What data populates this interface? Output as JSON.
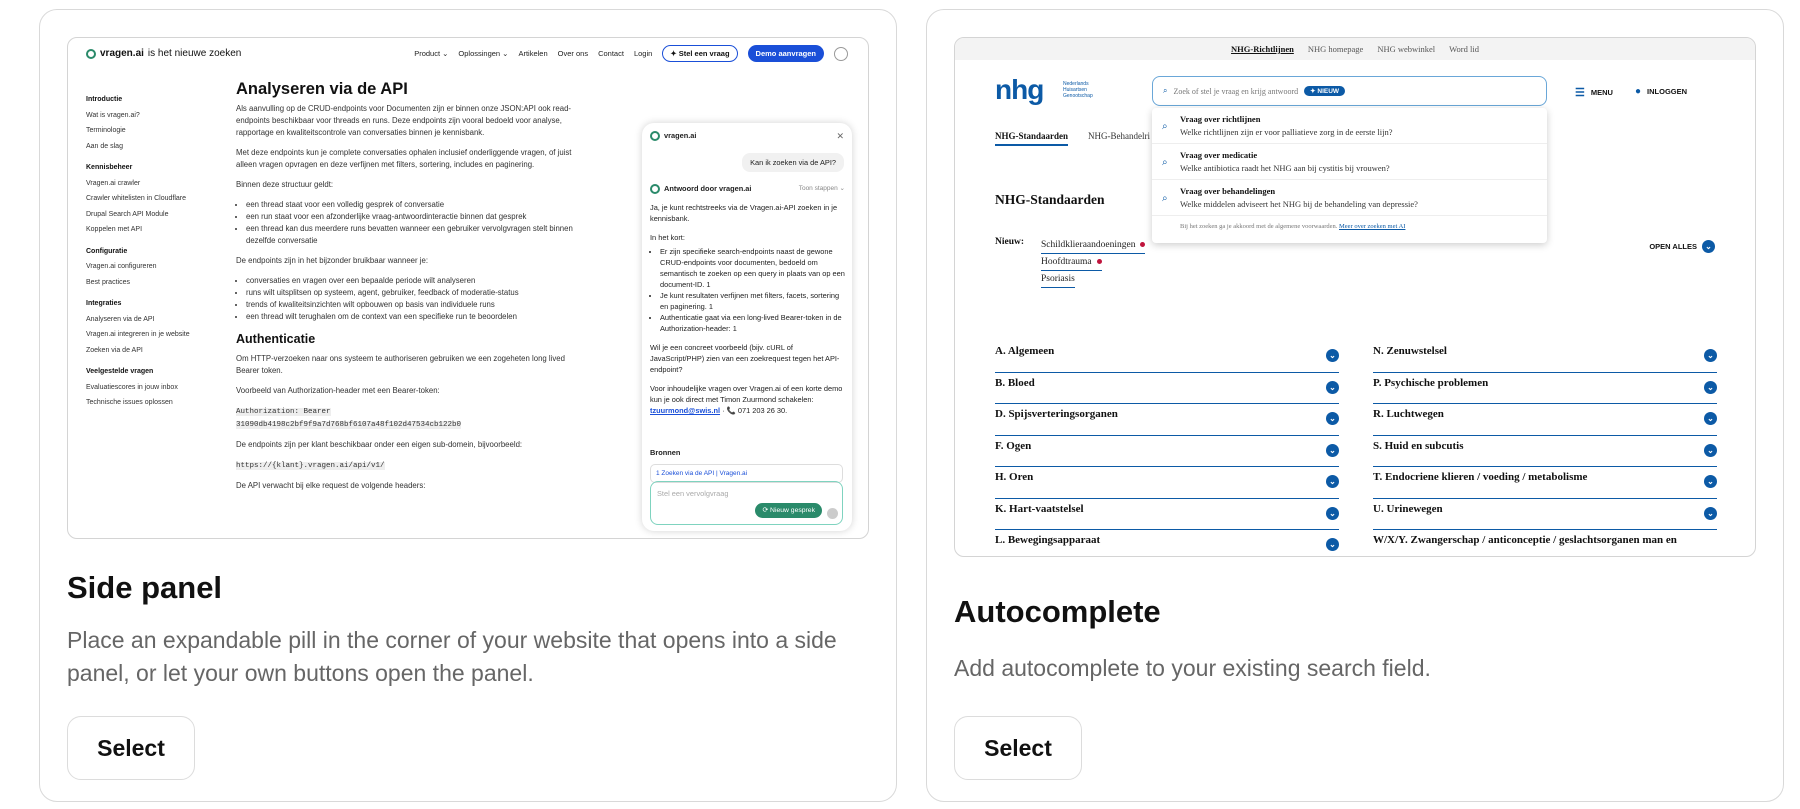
{
  "cards": [
    {
      "title": "Side panel",
      "description": "Place an expandable pill in the corner of your website that opens into a side panel, or let your own buttons open the panel.",
      "button": "Select"
    },
    {
      "title": "Autocomplete",
      "description": "Add autocomplete to your existing search field.",
      "button": "Select"
    }
  ],
  "preview1": {
    "logo": "vragen.ai",
    "logo_suffix": "is het nieuwe zoeken",
    "nav": [
      "Product ⌄",
      "Oplossingen ⌄",
      "Artikelen",
      "Over ons",
      "Contact",
      "Login"
    ],
    "pill_ask": "Stel een vraag",
    "pill_demo": "Demo aanvragen",
    "sidebar": [
      {
        "h": "Introductie",
        "items": [
          "Wat is vragen.ai?",
          "Terminologie",
          "Aan de slag"
        ]
      },
      {
        "h": "Kennisbeheer",
        "items": [
          "Vragen.ai crawler",
          "Crawler whitelisten in Cloudflare",
          "Drupal Search API Module",
          "Koppelen met API"
        ]
      },
      {
        "h": "Configuratie",
        "items": [
          "Vragen.ai configureren",
          "Best practices"
        ]
      },
      {
        "h": "Integraties",
        "items": [
          "Analyseren via de API",
          "Vragen.ai integreren in je website",
          "Zoeken via de API"
        ]
      },
      {
        "h": "Veelgestelde vragen",
        "items": [
          "Evaluatiescores in jouw inbox",
          "Technische issues oplossen"
        ]
      }
    ],
    "heading": "Analyseren via de API",
    "p1": "Als aanvulling op de CRUD-endpoints voor Documenten zijn er binnen onze JSON:API ook read-endpoints beschikbaar voor threads en runs. Deze endpoints zijn vooral bedoeld voor analyse, rapportage en kwaliteitscontrole van conversaties binnen je kennisbank.",
    "p2": "Met deze endpoints kun je complete conversaties ophalen inclusief onderliggende vragen, of juist alleen vragen opvragen en deze verfijnen met filters, sortering, includes en paginering.",
    "p3": "Binnen deze structuur geldt:",
    "list1": [
      "een thread staat voor een volledig gesprek of conversatie",
      "een run staat voor een afzonderlijke vraag-antwoordinteractie binnen dat gesprek",
      "een thread kan dus meerdere runs bevatten wanneer een gebruiker vervolgvragen stelt binnen dezelfde conversatie"
    ],
    "p4": "De endpoints zijn in het bijzonder bruikbaar wanneer je:",
    "list2": [
      "conversaties en vragen over een bepaalde periode wilt analyseren",
      "runs wilt uitsplitsen op systeem, agent, gebruiker, feedback of moderatie-status",
      "trends of kwaliteitsinzichten wilt opbouwen op basis van individuele runs",
      "een thread wilt terughalen om de context van een specifieke run te beoordelen"
    ],
    "heading2": "Authenticatie",
    "p5": "Om HTTP-verzoeken naar ons systeem te authoriseren gebruiken we een zogeheten long lived Bearer token.",
    "p6": "Voorbeeld van Authorization-header met een Bearer-token:",
    "code1": "Authorization: Bearer",
    "code2": "31090db4198c2bf9f9a7d768bf6107a48f102d47534cb122b0",
    "p7": "De endpoints zijn per klant beschikbaar onder een eigen sub-domein, bijvoorbeeld:",
    "code3": "https://{klant}.vragen.ai/api/v1/",
    "p8": "De API verwacht bij elke request de volgende headers:",
    "chat": {
      "brand": "vragen.ai",
      "question": "Kan ik zoeken via de API?",
      "answer_title": "Antwoord door vragen.ai",
      "toon": "Toon stappen ⌄",
      "a1": "Ja, je kunt rechtstreeks via de Vragen.ai-API zoeken in je kennisbank.",
      "a2": "In het kort:",
      "b1": "Er zijn specifieke search-endpoints naast de gewone CRUD-endpoints voor documenten, bedoeld om semantisch te zoeken op een query in plaats van op een document-ID. 1",
      "b2": "Je kunt resultaten verfijnen met filters, facets, sortering en paginering. 1",
      "b3": "Authenticatie gaat via een long-lived Bearer-token in de Authorization-header: 1",
      "a3": "Wil je een concreet voorbeeld (bijv. cURL of JavaScript/PHP) zien van een zoekrequest tegen het API-endpoint?",
      "a4": "Voor inhoudelijke vragen over Vragen.ai of een korte demo kun je ook direct met Timon Zuurmond schakelen:",
      "email": "tzuurmond@swis.nl",
      "phone": " · 📞 071 203 26 30.",
      "sources": "Bronnen",
      "source1": "1  Zoeken via de API | Vragen.ai",
      "placeholder": "Stel een vervolgvraag",
      "new": "Nieuw gesprek"
    }
  },
  "preview2": {
    "top_links": [
      "NHG-Richtlijnen",
      "NHG homepage",
      "NHG webwinkel",
      "Word lid"
    ],
    "logo": "nhg",
    "logo_sub": "Nederlands Huisartsen Genootschap",
    "search_placeholder": "Zoek of stel je vraag en krijg antwoord",
    "nieuw": "NIEUW",
    "menu": "MENU",
    "login": "INLOGGEN",
    "tabs": [
      "NHG-Standaarden",
      "NHG-Behandelri"
    ],
    "suggestions": [
      {
        "title": "Vraag over richtlijnen",
        "text": "Welke richtlijnen zijn er voor palliatieve zorg in de eerste lijn?"
      },
      {
        "title": "Vraag over medicatie",
        "text": "Welke antibiotica raadt het NHG aan bij cystitis bij vrouwen?"
      },
      {
        "title": "Vraag over behandelingen",
        "text": "Welke middelen adviseert het NHG bij de behandeling van depressie?"
      }
    ],
    "footer_text": "Bij het zoeken ga je akkoord met de algemene voorwaarden.",
    "footer_link": "Meer over zoeken met AI",
    "heading": "NHG-Standaarden",
    "nieuw_label": "Nieuw:",
    "new_items": [
      "Schildklieraandoeningen",
      "Hoofdtrauma",
      "Psoriasis"
    ],
    "open_all": "OPEN ALLES",
    "categories": [
      "A. Algemeen",
      "N. Zenuwstelsel",
      "B. Bloed",
      "P. Psychische problemen",
      "D. Spijsverteringsorganen",
      "R. Luchtwegen",
      "F. Ogen",
      "S. Huid en subcutis",
      "H. Oren",
      "T. Endocriene klieren / voeding / metabolisme",
      "K. Hart-vaatstelsel",
      "U. Urinewegen",
      "L. Bewegingsapparaat",
      "W/X/Y. Zwangerschap / anticonceptie / geslachtsorganen man en"
    ]
  }
}
